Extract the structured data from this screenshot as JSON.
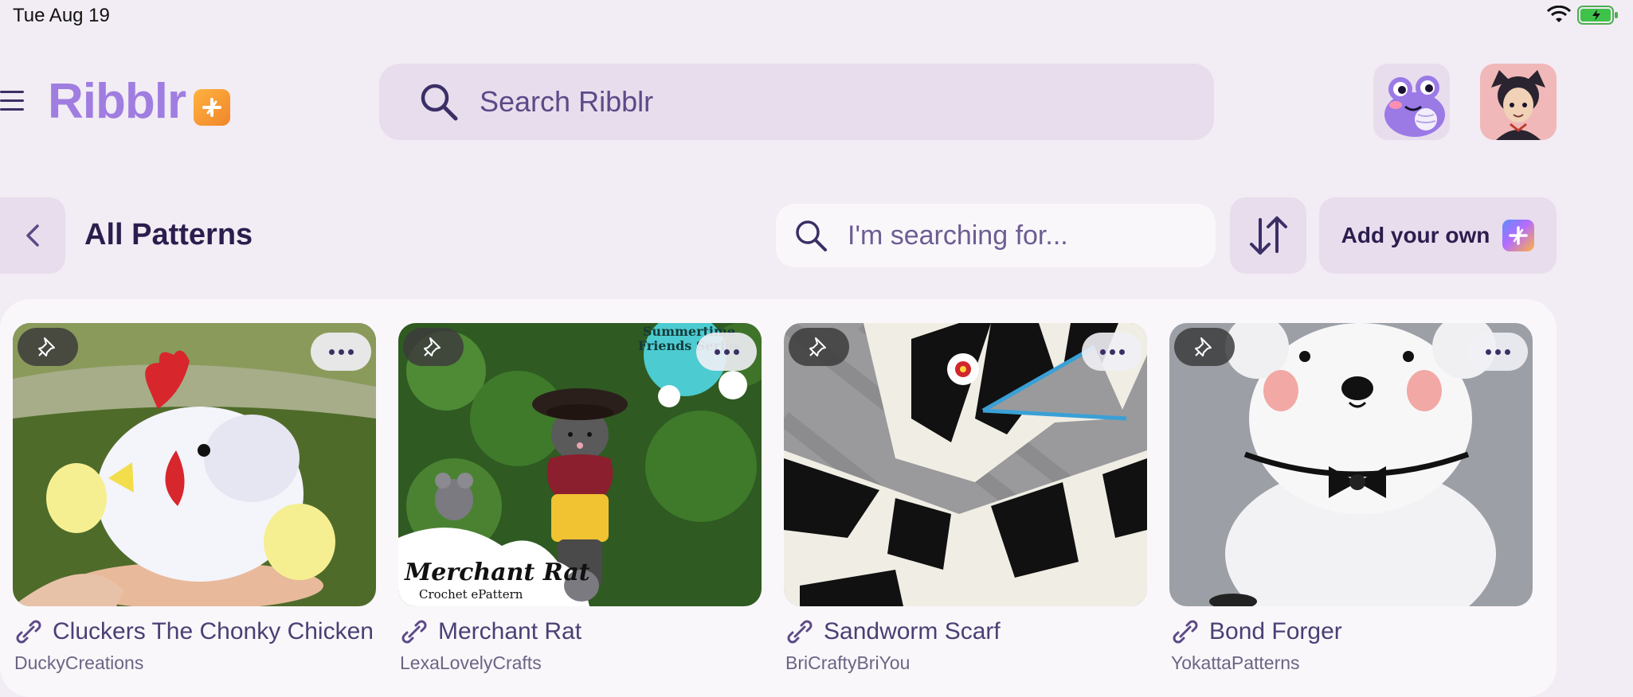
{
  "status_bar": {
    "time": "Tue Aug 19"
  },
  "header": {
    "logo_text": "Ribblr",
    "search_placeholder": "Search Ribblr"
  },
  "toolbar": {
    "title": "All Patterns",
    "search_placeholder": "I'm searching for...",
    "add_label": "Add your own"
  },
  "patterns": [
    {
      "name": "Cluckers The Chonky Chicken",
      "author": "DuckyCreations"
    },
    {
      "name": "Merchant Rat",
      "author": "LexaLovelyCrafts",
      "image_text": {
        "badge": "Summertime Friends Series",
        "caption": "Merchant Rat",
        "subcaption": "Crochet ePattern"
      }
    },
    {
      "name": "Sandworm Scarf",
      "author": "BriCraftyBriYou"
    },
    {
      "name": "Bond Forger",
      "author": "YokattaPatterns"
    }
  ],
  "icons": {
    "menu": "hamburger-icon",
    "search": "search-icon",
    "back": "chevron-left-icon",
    "sort": "sort-arrows-icon",
    "pin": "pin-icon",
    "more": "ellipsis-icon",
    "link": "link-icon"
  },
  "colors": {
    "brand": "#a07de0",
    "background": "#f2ecf4",
    "accent_orange": "#f59a2f"
  }
}
